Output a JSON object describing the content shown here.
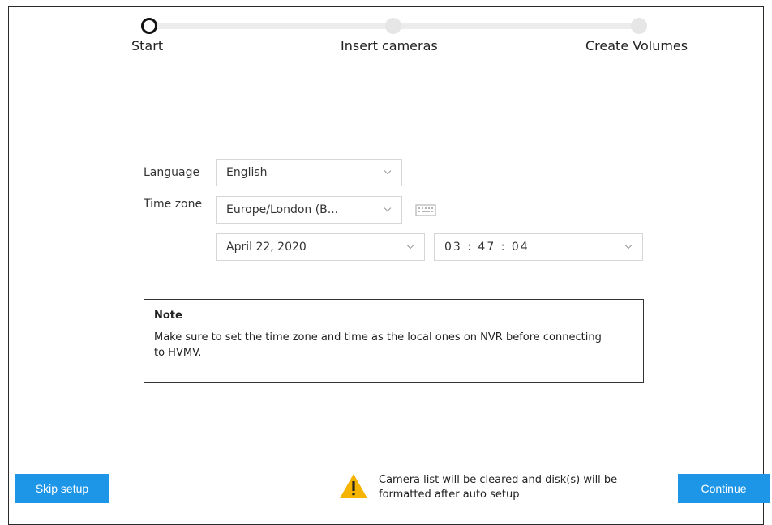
{
  "stepper": {
    "steps": [
      {
        "label": "Start",
        "active": true
      },
      {
        "label": "Insert cameras",
        "active": false
      },
      {
        "label": "Create Volumes",
        "active": false
      }
    ]
  },
  "form": {
    "language_label": "Language",
    "language_value": "English",
    "timezone_label": "Time zone",
    "timezone_value": "Europe/London (B...",
    "date_value": "April 22, 2020",
    "time_value": "03 : 47 : 04",
    "keyboard_icon": "keyboard-icon"
  },
  "note": {
    "title": "Note",
    "text": "Make sure to set the time zone and time as the local ones on NVR before connecting to HVMV."
  },
  "footer": {
    "skip_label": "Skip setup",
    "continue_label": "Continue",
    "warning_text": "Camera list will be cleared and disk(s) will be formatted after auto setup",
    "warning_icon": "warning-icon"
  },
  "colors": {
    "accent": "#1e96e8",
    "warning": "#f5b400"
  }
}
